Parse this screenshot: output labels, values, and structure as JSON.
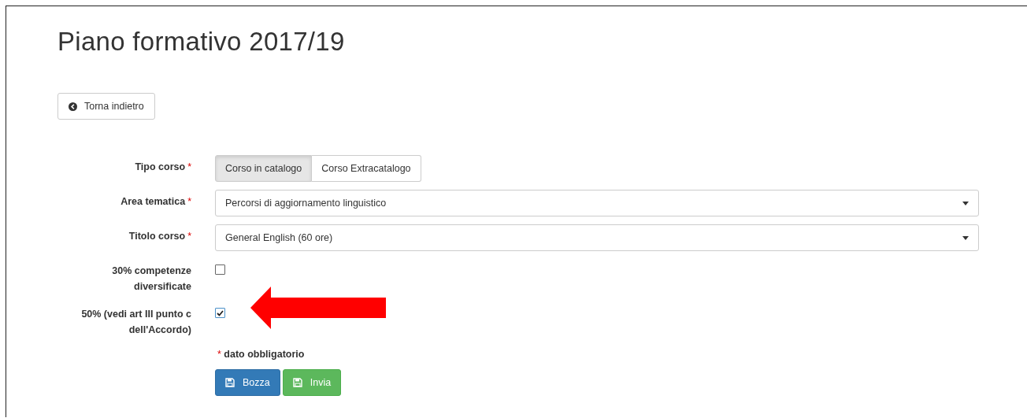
{
  "title": "Piano formativo 2017/19",
  "back_button": {
    "label": "Torna indietro"
  },
  "form_rows": [
    {
      "kind": "toggle",
      "label": "Tipo corso",
      "required_mark": "*",
      "options": [
        {
          "label": "Corso in catalogo",
          "selected": true
        },
        {
          "label": "Corso Extracatalogo",
          "selected": false
        }
      ]
    },
    {
      "kind": "select",
      "label": "Area tematica",
      "required_mark": "*",
      "value": "Percorsi di aggiornamento linguistico"
    },
    {
      "kind": "select",
      "label": "Titolo corso",
      "required_mark": "*",
      "value": "General English (60 ore)"
    },
    {
      "kind": "checkbox",
      "label": "30% competenze diversificate",
      "checked": false,
      "highlighted": false
    },
    {
      "kind": "checkbox",
      "label": "50% (vedi art III punto c dell'Accordo)",
      "checked": true,
      "highlighted": true
    }
  ],
  "required_note": {
    "mark": "*",
    "text": "dato obbligatorio"
  },
  "buttons": [
    {
      "kind": "primary",
      "label": "Bozza"
    },
    {
      "kind": "success",
      "label": "Invia"
    }
  ]
}
